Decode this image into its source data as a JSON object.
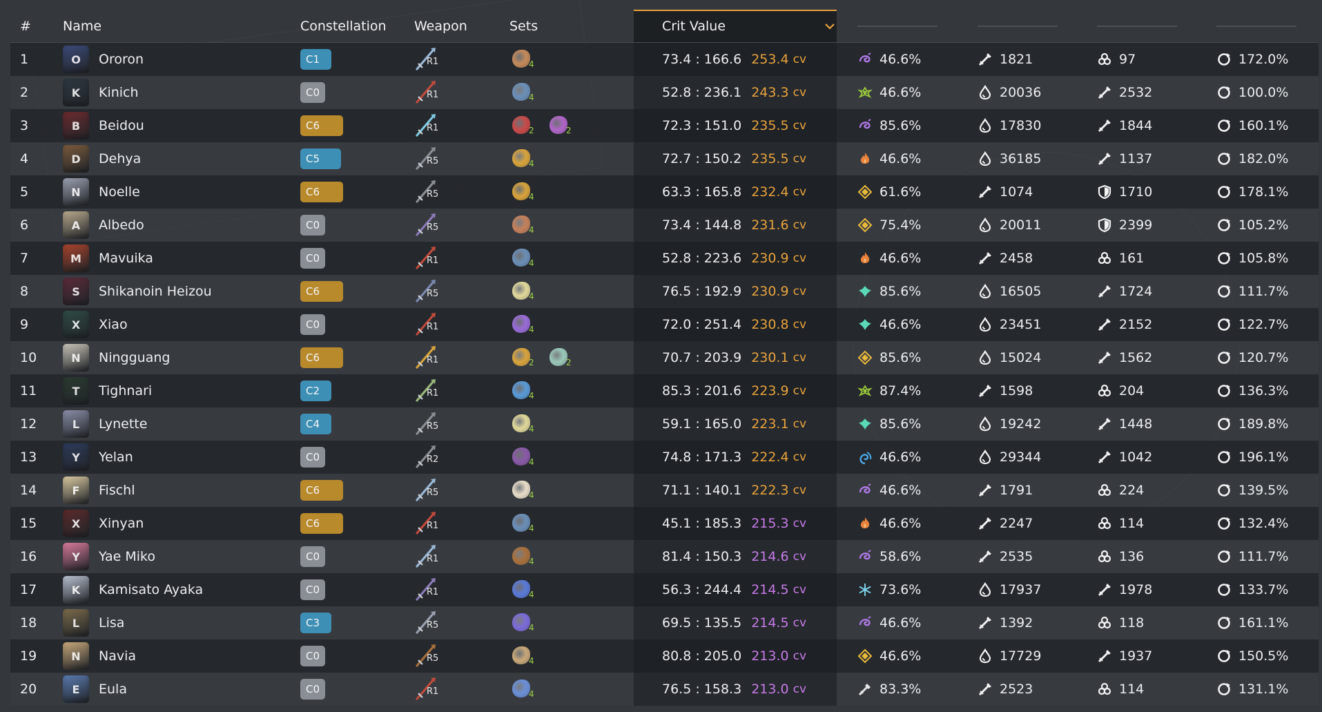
{
  "headers": {
    "rank": "#",
    "name": "Name",
    "constellation": "Constellation",
    "weapon": "Weapon",
    "sets": "Sets",
    "crit_value": "Crit Value"
  },
  "colors": {
    "cv_orange": "#e8a33d",
    "cv_purple": "#c77be8",
    "const_gold": "#b88a2c",
    "const_blue": "#3d8fb5",
    "const_grey": "#8a8f96",
    "set_count_green": "#9fd14a",
    "accent_border": "#e8a33d"
  },
  "rows": [
    {
      "rank": "1",
      "name": "Ororon",
      "const": "C1",
      "refine": "R1",
      "sets": [
        {
          "count": "4",
          "color": "#c58a5a"
        }
      ],
      "crit": "73.4 : 166.6",
      "cv": "253.4",
      "unit": "cv",
      "cv_color": "orange",
      "s1_icon": "electro-icon",
      "s1": "46.6%",
      "s2_icon": "atk-icon",
      "s2": "1821",
      "s3_icon": "em-icon",
      "s3": "97",
      "s4_icon": "er-icon",
      "s4": "172.0%",
      "av": "#3b4a78",
      "wc": "#9ab8d6"
    },
    {
      "rank": "2",
      "name": "Kinich",
      "const": "C0",
      "refine": "R1",
      "sets": [
        {
          "count": "4",
          "color": "#6b8fb8"
        }
      ],
      "crit": "52.8 : 236.1",
      "cv": "243.3",
      "unit": "cv",
      "cv_color": "orange",
      "s1_icon": "dendro-icon",
      "s1": "46.6%",
      "s2_icon": "hp-icon",
      "s2": "20036",
      "s3_icon": "atk-icon",
      "s3": "2532",
      "s4_icon": "er-icon",
      "s4": "100.0%",
      "av": "#2c3640",
      "wc": "#c04b3c"
    },
    {
      "rank": "3",
      "name": "Beidou",
      "const": "C6",
      "refine": "R1",
      "sets": [
        {
          "count": "2",
          "color": "#c84a4a"
        },
        {
          "count": "2",
          "color": "#b066c8"
        }
      ],
      "crit": "72.3 : 151.0",
      "cv": "235.5",
      "unit": "cv",
      "cv_color": "orange",
      "s1_icon": "electro-icon",
      "s1": "85.6%",
      "s2_icon": "hp-icon",
      "s2": "17830",
      "s3_icon": "atk-icon",
      "s3": "1844",
      "s4_icon": "er-icon",
      "s4": "160.1%",
      "av": "#6b2a2e",
      "wc": "#7ec8e0"
    },
    {
      "rank": "4",
      "name": "Dehya",
      "const": "C5",
      "refine": "R5",
      "sets": [
        {
          "count": "4",
          "color": "#d8a33c"
        }
      ],
      "crit": "72.7 : 150.2",
      "cv": "235.5",
      "unit": "cv",
      "cv_color": "orange",
      "s1_icon": "pyro-icon",
      "s1": "46.6%",
      "s2_icon": "hp-icon",
      "s2": "36185",
      "s3_icon": "atk-icon",
      "s3": "1137",
      "s4_icon": "er-icon",
      "s4": "182.0%",
      "av": "#7a5a3c",
      "wc": "#8a8f96"
    },
    {
      "rank": "5",
      "name": "Noelle",
      "const": "C6",
      "refine": "R5",
      "sets": [
        {
          "count": "4",
          "color": "#d8a33c"
        }
      ],
      "crit": "63.3 : 165.8",
      "cv": "232.4",
      "unit": "cv",
      "cv_color": "orange",
      "s1_icon": "geo-icon",
      "s1": "61.6%",
      "s2_icon": "atk-icon",
      "s2": "1074",
      "s3_icon": "def-icon",
      "s3": "1710",
      "s4_icon": "er-icon",
      "s4": "178.1%",
      "av": "#9aa0b0",
      "wc": "#8a8f96"
    },
    {
      "rank": "6",
      "name": "Albedo",
      "const": "C0",
      "refine": "R5",
      "sets": [
        {
          "count": "4",
          "color": "#c5805a"
        }
      ],
      "crit": "73.4 : 144.8",
      "cv": "231.6",
      "unit": "cv",
      "cv_color": "orange",
      "s1_icon": "geo-icon",
      "s1": "75.4%",
      "s2_icon": "hp-icon",
      "s2": "20011",
      "s3_icon": "def-icon",
      "s3": "2399",
      "s4_icon": "er-icon",
      "s4": "105.2%",
      "av": "#b8a88c",
      "wc": "#8c7bb8"
    },
    {
      "rank": "7",
      "name": "Mavuika",
      "const": "C0",
      "refine": "R1",
      "sets": [
        {
          "count": "4",
          "color": "#6b8fb8"
        }
      ],
      "crit": "52.8 : 223.6",
      "cv": "230.9",
      "unit": "cv",
      "cv_color": "orange",
      "s1_icon": "pyro-icon",
      "s1": "46.6%",
      "s2_icon": "atk-icon",
      "s2": "2458",
      "s3_icon": "em-icon",
      "s3": "161",
      "s4_icon": "er-icon",
      "s4": "105.8%",
      "av": "#a8432c",
      "wc": "#c04b3c"
    },
    {
      "rank": "8",
      "name": "Shikanoin Heizou",
      "const": "C6",
      "refine": "R5",
      "sets": [
        {
          "count": "4",
          "color": "#e0d89a"
        }
      ],
      "crit": "76.5 : 192.9",
      "cv": "230.9",
      "unit": "cv",
      "cv_color": "orange",
      "s1_icon": "anemo-icon",
      "s1": "85.6%",
      "s2_icon": "hp-icon",
      "s2": "16505",
      "s3_icon": "atk-icon",
      "s3": "1724",
      "s4_icon": "er-icon",
      "s4": "111.7%",
      "av": "#5a2a38",
      "wc": "#7a8ab0"
    },
    {
      "rank": "9",
      "name": "Xiao",
      "const": "C0",
      "refine": "R1",
      "sets": [
        {
          "count": "4",
          "color": "#9a6bd8"
        }
      ],
      "crit": "72.0 : 251.4",
      "cv": "230.8",
      "unit": "cv",
      "cv_color": "orange",
      "s1_icon": "anemo-icon",
      "s1": "46.6%",
      "s2_icon": "hp-icon",
      "s2": "23451",
      "s3_icon": "atk-icon",
      "s3": "2152",
      "s4_icon": "er-icon",
      "s4": "122.7%",
      "av": "#2e4a44",
      "wc": "#c04b3c"
    },
    {
      "rank": "10",
      "name": "Ningguang",
      "const": "C6",
      "refine": "R1",
      "sets": [
        {
          "count": "2",
          "color": "#d8a33c"
        },
        {
          "count": "2",
          "color": "#9ac8b8"
        }
      ],
      "crit": "70.7 : 203.9",
      "cv": "230.1",
      "unit": "cv",
      "cv_color": "orange",
      "s1_icon": "geo-icon",
      "s1": "85.6%",
      "s2_icon": "hp-icon",
      "s2": "15024",
      "s3_icon": "atk-icon",
      "s3": "1562",
      "s4_icon": "er-icon",
      "s4": "120.7%",
      "av": "#c8c4b8",
      "wc": "#d8a33c"
    },
    {
      "rank": "11",
      "name": "Tighnari",
      "const": "C2",
      "refine": "R1",
      "sets": [
        {
          "count": "4",
          "color": "#5a9ad8"
        }
      ],
      "crit": "85.3 : 201.6",
      "cv": "223.9",
      "unit": "cv",
      "cv_color": "orange",
      "s1_icon": "dendro-icon",
      "s1": "87.4%",
      "s2_icon": "atk-icon",
      "s2": "1598",
      "s3_icon": "em-icon",
      "s3": "204",
      "s4_icon": "er-icon",
      "s4": "136.3%",
      "av": "#2a3a30",
      "wc": "#9ab87a"
    },
    {
      "rank": "12",
      "name": "Lynette",
      "const": "C4",
      "refine": "R5",
      "sets": [
        {
          "count": "4",
          "color": "#e0d89a"
        }
      ],
      "crit": "59.1 : 165.0",
      "cv": "223.1",
      "unit": "cv",
      "cv_color": "orange",
      "s1_icon": "anemo-icon",
      "s1": "85.6%",
      "s2_icon": "hp-icon",
      "s2": "19242",
      "s3_icon": "atk-icon",
      "s3": "1448",
      "s4_icon": "er-icon",
      "s4": "189.8%",
      "av": "#8a8ea8",
      "wc": "#8a8f96"
    },
    {
      "rank": "13",
      "name": "Yelan",
      "const": "C0",
      "refine": "R2",
      "sets": [
        {
          "count": "4",
          "color": "#8a5aa8"
        }
      ],
      "crit": "74.8 : 171.3",
      "cv": "222.4",
      "unit": "cv",
      "cv_color": "orange",
      "s1_icon": "hydro-icon",
      "s1": "46.6%",
      "s2_icon": "hp-icon",
      "s2": "29344",
      "s3_icon": "atk-icon",
      "s3": "1042",
      "s4_icon": "er-icon",
      "s4": "196.1%",
      "av": "#2c3a5a",
      "wc": "#8a8f96"
    },
    {
      "rank": "14",
      "name": "Fischl",
      "const": "C6",
      "refine": "R5",
      "sets": [
        {
          "count": "4",
          "color": "#e8dcc8"
        }
      ],
      "crit": "71.1 : 140.1",
      "cv": "222.3",
      "unit": "cv",
      "cv_color": "orange",
      "s1_icon": "electro-icon",
      "s1": "46.6%",
      "s2_icon": "atk-icon",
      "s2": "1791",
      "s3_icon": "em-icon",
      "s3": "224",
      "s4_icon": "er-icon",
      "s4": "139.5%",
      "av": "#d8c8a0",
      "wc": "#9ab8d6"
    },
    {
      "rank": "15",
      "name": "Xinyan",
      "const": "C6",
      "refine": "R1",
      "sets": [
        {
          "count": "4",
          "color": "#6b8fb8"
        }
      ],
      "crit": "45.1 : 185.3",
      "cv": "215.3",
      "unit": "cv",
      "cv_color": "purple",
      "s1_icon": "pyro-icon",
      "s1": "46.6%",
      "s2_icon": "atk-icon",
      "s2": "2247",
      "s3_icon": "em-icon",
      "s3": "114",
      "s4_icon": "er-icon",
      "s4": "132.4%",
      "av": "#5a2a2a",
      "wc": "#c04b3c"
    },
    {
      "rank": "16",
      "name": "Yae Miko",
      "const": "C0",
      "refine": "R1",
      "sets": [
        {
          "count": "4",
          "color": "#a8703c"
        }
      ],
      "crit": "81.4 : 150.3",
      "cv": "214.6",
      "unit": "cv",
      "cv_color": "purple",
      "s1_icon": "electro-icon",
      "s1": "58.6%",
      "s2_icon": "atk-icon",
      "s2": "2535",
      "s3_icon": "em-icon",
      "s3": "136",
      "s4_icon": "er-icon",
      "s4": "111.7%",
      "av": "#d87a9a",
      "wc": "#9ab8d6"
    },
    {
      "rank": "17",
      "name": "Kamisato Ayaka",
      "const": "C0",
      "refine": "R1",
      "sets": [
        {
          "count": "4",
          "color": "#5a7ad8"
        }
      ],
      "crit": "56.3 : 244.4",
      "cv": "214.5",
      "unit": "cv",
      "cv_color": "purple",
      "s1_icon": "cryo-icon",
      "s1": "73.6%",
      "s2_icon": "hp-icon",
      "s2": "17937",
      "s3_icon": "atk-icon",
      "s3": "1978",
      "s4_icon": "er-icon",
      "s4": "133.7%",
      "av": "#b8c0d0",
      "wc": "#8c7bb8"
    },
    {
      "rank": "18",
      "name": "Lisa",
      "const": "C3",
      "refine": "R5",
      "sets": [
        {
          "count": "4",
          "color": "#7a6bd8"
        }
      ],
      "crit": "69.5 : 135.5",
      "cv": "214.5",
      "unit": "cv",
      "cv_color": "purple",
      "s1_icon": "electro-icon",
      "s1": "46.6%",
      "s2_icon": "atk-icon",
      "s2": "1392",
      "s3_icon": "em-icon",
      "s3": "118",
      "s4_icon": "er-icon",
      "s4": "161.1%",
      "av": "#7a6a4a",
      "wc": "#9aa0b0"
    },
    {
      "rank": "19",
      "name": "Navia",
      "const": "C0",
      "refine": "R5",
      "sets": [
        {
          "count": "4",
          "color": "#c8a87a"
        }
      ],
      "crit": "80.8 : 205.0",
      "cv": "213.0",
      "unit": "cv",
      "cv_color": "purple",
      "s1_icon": "geo-icon",
      "s1": "46.6%",
      "s2_icon": "hp-icon",
      "s2": "17729",
      "s3_icon": "atk-icon",
      "s3": "1937",
      "s4_icon": "er-icon",
      "s4": "150.5%",
      "av": "#c8a87a",
      "wc": "#a8703c"
    },
    {
      "rank": "20",
      "name": "Eula",
      "const": "C0",
      "refine": "R1",
      "sets": [
        {
          "count": "4",
          "color": "#6b8fd8"
        }
      ],
      "crit": "76.5 : 158.3",
      "cv": "213.0",
      "unit": "cv",
      "cv_color": "purple",
      "s1_icon": "physical-icon",
      "s1": "83.3%",
      "s2_icon": "atk-icon",
      "s2": "2523",
      "s3_icon": "em-icon",
      "s3": "114",
      "s4_icon": "er-icon",
      "s4": "131.1%",
      "av": "#5a7ab0",
      "wc": "#c04b3c"
    }
  ]
}
